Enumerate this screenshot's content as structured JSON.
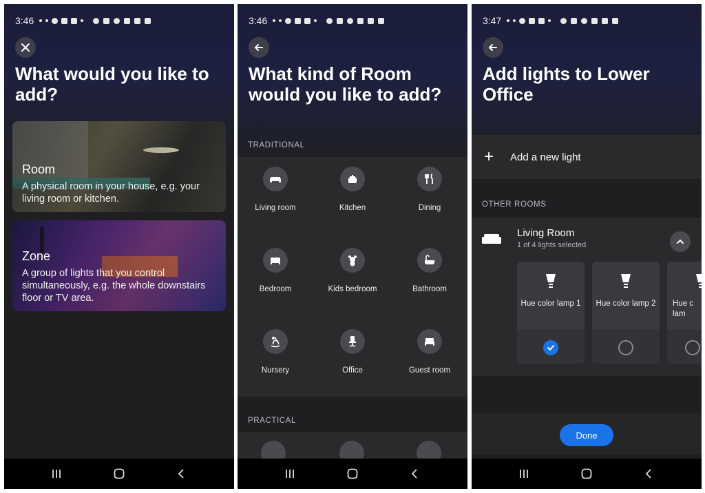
{
  "panels": [
    {
      "time": "3:46",
      "title": "What would you like to add?",
      "cards": [
        {
          "title": "Room",
          "description": "A physical room in your house, e.g. your living room or kitchen."
        },
        {
          "title": "Zone",
          "description": "A group of lights that you control simultaneously, e.g. the whole downstairs floor or TV area."
        }
      ]
    },
    {
      "time": "3:46",
      "title": "What kind of Room would you like to add?",
      "section_traditional": "TRADITIONAL",
      "section_practical": "PRACTICAL",
      "room_types": [
        "Living room",
        "Kitchen",
        "Dining",
        "Bedroom",
        "Kids bedroom",
        "Bathroom",
        "Nursery",
        "Office",
        "Guest room"
      ]
    },
    {
      "time": "3:47",
      "title": "Add lights to Lower Office",
      "add_new_light": "Add a new light",
      "section_other_rooms": "OTHER ROOMS",
      "room_name": "Living Room",
      "room_subtitle": "1 of 4 lights selected",
      "lamps": [
        {
          "name": "Hue color lamp 1",
          "selected": true
        },
        {
          "name": "Hue color lamp 2",
          "selected": false
        },
        {
          "name": "Hue c lam",
          "selected": false
        }
      ],
      "done_label": "Done"
    }
  ],
  "colors": {
    "accent": "#1a73e8",
    "background": "#1f1f21",
    "card": "#2a2a2c"
  }
}
